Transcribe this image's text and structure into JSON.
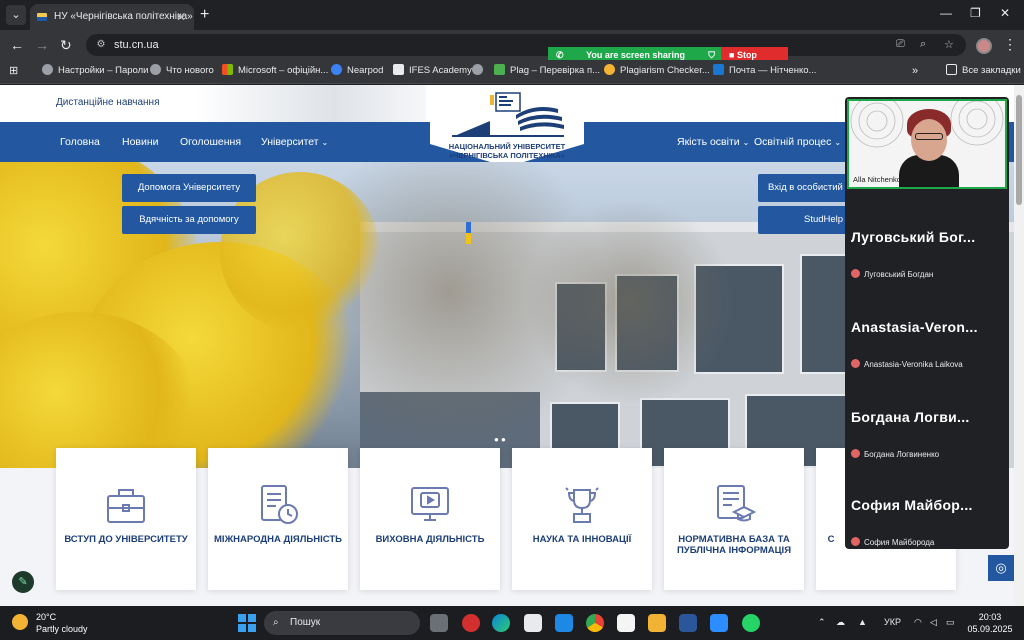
{
  "browser": {
    "tab_title": "НУ «Чернігівська політехніка»",
    "url": "stu.cn.ua",
    "bookmarks": [
      {
        "label": "Настройки – Пароли",
        "icon": "gear-icon"
      },
      {
        "label": "Что нового",
        "icon": "globe-icon"
      },
      {
        "label": "Microsoft – офіційн...",
        "icon": "microsoft-icon"
      },
      {
        "label": "Nearpod",
        "icon": "nearpod-icon"
      },
      {
        "label": "IFES Academy",
        "icon": "ifes-icon"
      },
      {
        "label": "",
        "icon": "globe-icon"
      },
      {
        "label": "Plag – Перевірка п...",
        "icon": "plag-icon"
      },
      {
        "label": "Plagiarism Checker...",
        "icon": "search-icon"
      },
      {
        "label": "Почта — Нітченко...",
        "icon": "mail-icon"
      }
    ],
    "all_bookmarks": "Все закладки"
  },
  "share_banner": {
    "sharing_text": "You are screen sharing",
    "stop_label": "Stop share"
  },
  "site": {
    "distance_learning": "Дистанційне навчання",
    "menu": [
      "Головна",
      "Новини",
      "Оголошення",
      "Університет"
    ],
    "menu_right": [
      "Якість освіти",
      "Освітній процес"
    ],
    "logo_line1": "НАЦІОНАЛЬНИЙ УНІВЕРСИТЕТ",
    "logo_line2": "«ЧЕРНІГІВСЬКА ПОЛІТЕХНІКА»",
    "hero_buttons_left": [
      "Допомога Університету",
      "Вдячність за допомогу"
    ],
    "hero_buttons_right": [
      "Вхід в особистий",
      "StudHelp"
    ],
    "cards": [
      {
        "label": "ВСТУП ДО УНІВЕРСИТЕТУ",
        "icon": "briefcase-icon"
      },
      {
        "label": "МІЖНАРОДНА ДІЯЛЬНІСТЬ",
        "icon": "document-clock-icon"
      },
      {
        "label": "ВИХОВНА ДІЯЛЬНІСТЬ",
        "icon": "monitor-play-icon"
      },
      {
        "label": "НАУКА ТА ІННОВАЦІЇ",
        "icon": "trophy-icon"
      },
      {
        "label": "НОРМАТИВНА БАЗА ТА ПУБЛІЧНА ІНФОРМАЦІЯ",
        "icon": "graduation-doc-icon"
      },
      {
        "label": "С",
        "icon": "card-icon"
      }
    ]
  },
  "meeting": {
    "self_name": "Alla Nitchenko",
    "participants": [
      {
        "big": "Луговський Бог...",
        "small": "Луговський Богдан"
      },
      {
        "big": "Anastasia-Veron...",
        "small": "Anastasia-Veronika Laikova"
      },
      {
        "big": "Богдана Логви...",
        "small": "Богдана Логвиненко"
      },
      {
        "big": "София Майбор...",
        "small": "София Майборода"
      }
    ]
  },
  "taskbar": {
    "temperature": "20°C",
    "weather": "Partly cloudy",
    "search_placeholder": "Пошук",
    "language": "УКР",
    "time": "20:03",
    "date": "05.09.2025"
  },
  "colors": {
    "brand_blue": "#2358a1",
    "share_green": "#1fa84a",
    "share_red": "#e02c2c"
  }
}
